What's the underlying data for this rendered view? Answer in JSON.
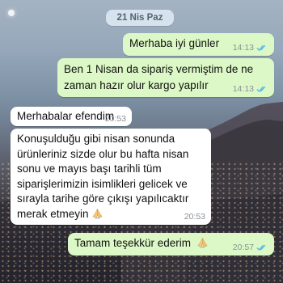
{
  "date_label": "21 Nis Paz",
  "messages": [
    {
      "text": "Merhaba iyi günler",
      "time": "14:13",
      "direction": "outgoing",
      "status": "read"
    },
    {
      "lines": [
        "Ben 1 Nisan da sipariş vermiştim de ne",
        "zaman hazır olur kargo yapılır"
      ],
      "time": "14:13",
      "direction": "outgoing",
      "status": "read"
    },
    {
      "text": "Merhabalar efendim",
      "time": "20:53",
      "direction": "incoming"
    },
    {
      "lines": [
        "Konuşulduğu gibi nisan sonunda",
        "ürünleriniz sizde olur bu hafta nisan",
        "sonu ve mayıs başı tarihli tüm",
        "siparişlerimizin isimlikleri gelicek ve",
        "sırayla tarihe göre çıkışı yapılıcaktır",
        "merak etmeyin"
      ],
      "time": "20:53",
      "direction": "incoming",
      "emoji": "folded-hands"
    },
    {
      "text": "Tamam teşekkür ederim",
      "time": "20:57",
      "direction": "outgoing",
      "status": "read",
      "emoji": "folded-hands"
    }
  ],
  "colors": {
    "outgoing_bubble": "#dcf8c6",
    "incoming_bubble": "#ffffff",
    "read_ticks": "#4fb6ec",
    "date_pill": "#d6e3ee"
  }
}
